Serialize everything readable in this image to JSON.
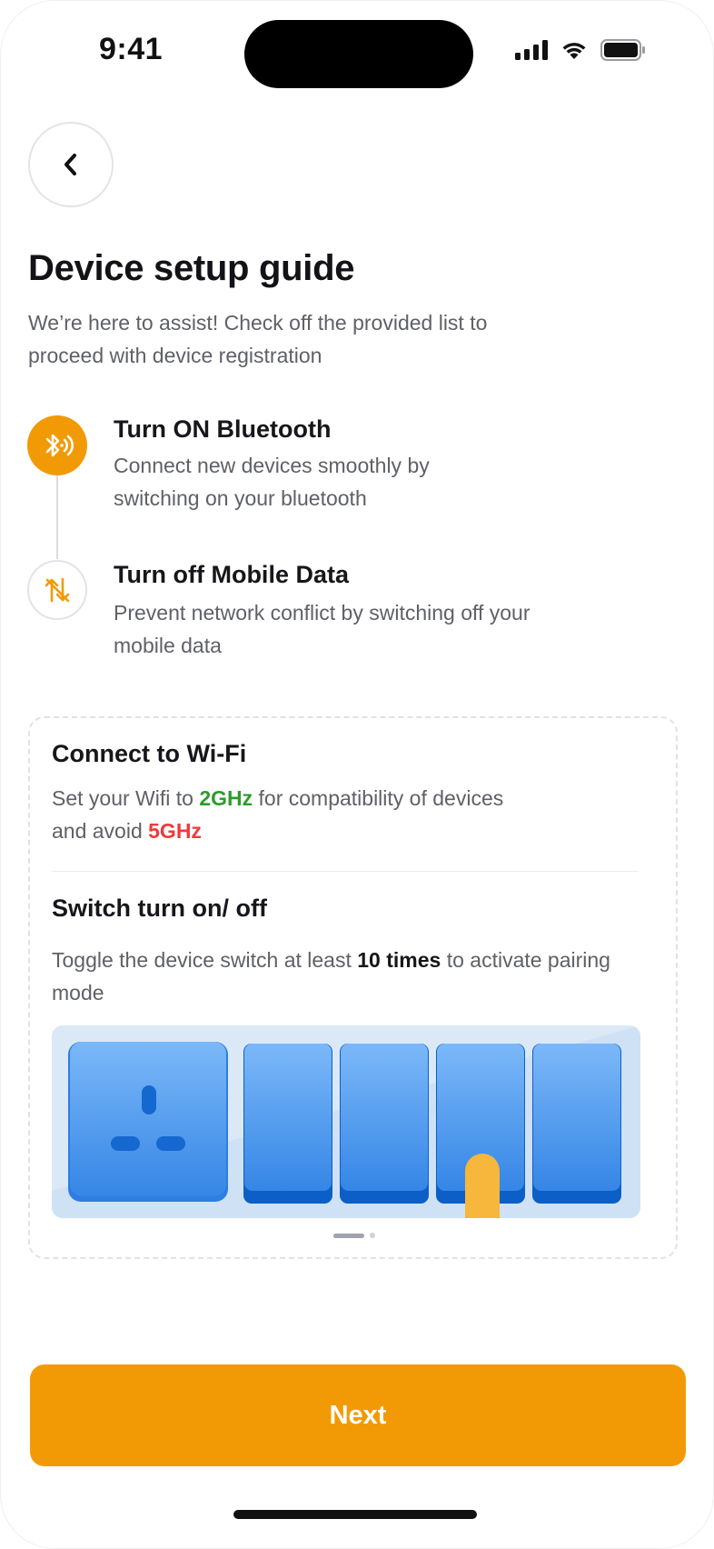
{
  "status_bar": {
    "time": "9:41"
  },
  "header": {
    "title": "Device setup guide",
    "subtitle": "We’re here to assist! Check off the provided list to proceed with device registration"
  },
  "steps": [
    {
      "title": "Turn ON Bluetooth",
      "desc": "Connect new devices smoothly by switching on your bluetooth",
      "icon": "bluetooth-icon",
      "state": "active"
    },
    {
      "title": "Turn off Mobile Data",
      "desc": "Prevent network conflict by switching off your mobile data",
      "icon": "mobile-data-off-icon",
      "state": "inactive"
    }
  ],
  "wifi": {
    "title": "Connect to Wi-Fi",
    "text_pre": "Set your Wifi to ",
    "good_band": "2GHz",
    "text_mid": " for compatibility of devices and avoid ",
    "bad_band": "5GHz"
  },
  "switch": {
    "title": "Switch turn on/ off",
    "text_pre": "Toggle the device switch at least ",
    "count": "10 times",
    "text_post": " to activate pairing mode"
  },
  "carousel": {
    "page": 1,
    "total": 2
  },
  "next_label": "Next",
  "colors": {
    "accent": "#F29A05",
    "good": "#2E9B2E",
    "bad": "#EC3B3B",
    "switch_blue": "#3B8CEB"
  }
}
